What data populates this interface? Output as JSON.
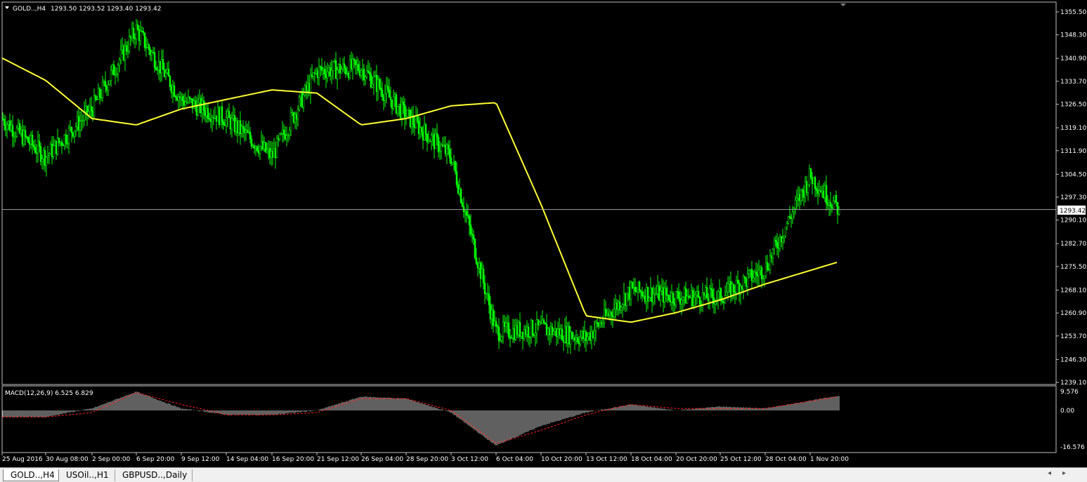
{
  "main_header": {
    "symbol_label": "GOLD..,H4",
    "ohlc": "1293.50 1293.52 1293.40 1293.42"
  },
  "price_axis": {
    "ticks": [
      "1355.50",
      "1348.30",
      "1340.90",
      "1333.70",
      "1326.50",
      "1319.10",
      "1311.90",
      "1304.50",
      "1297.30",
      "1290.10",
      "1282.70",
      "1275.50",
      "1268.10",
      "1260.90",
      "1253.70",
      "1246.30",
      "1239.10"
    ],
    "current_price": "1293.42"
  },
  "macd_header": "MACD(12,26,9) 6.525 6.829",
  "macd_axis": {
    "ticks": [
      "9.576",
      "0.00",
      "-16.576"
    ]
  },
  "time_axis": {
    "labels": [
      "25 Aug 2016",
      "30 Aug 08:00",
      "2 Sep 00:00",
      "6 Sep 20:00",
      "9 Sep 12:00",
      "14 Sep 04:00",
      "16 Sep 20:00",
      "21 Sep 12:00",
      "26 Sep 04:00",
      "28 Sep 20:00",
      "3 Oct 12:00",
      "6 Oct 04:00",
      "10 Oct 20:00",
      "13 Oct 12:00",
      "18 Oct 04:00",
      "20 Oct 20:00",
      "25 Oct 12:00",
      "28 Oct 04:00",
      "1 Nov 20:00"
    ]
  },
  "tabs": [
    {
      "label": "GOLD..,H4",
      "active": true
    },
    {
      "label": "USOil..,H1",
      "active": false
    },
    {
      "label": "GBPUSD..,Daily",
      "active": false
    }
  ],
  "colors": {
    "background": "#000000",
    "grid_text": "#ffffff",
    "candle": "#00ff00",
    "moving_average": "#ffff33",
    "macd_hist": "#c0c0c0",
    "macd_signal": "#ff2020"
  },
  "chart_data": {
    "type": "candlestick",
    "symbol": "GOLD..",
    "timeframe": "H4",
    "ylim": [
      1239.1,
      1358.0
    ],
    "indicators": [
      "moving average",
      "MACD(12,26,9)"
    ],
    "price_trend_keypoints": [
      {
        "x": "25 Aug 2016",
        "y": 1322
      },
      {
        "x": "30 Aug 08:00",
        "y": 1310
      },
      {
        "x": "2 Sep 00:00",
        "y": 1325
      },
      {
        "x": "6 Sep 20:00",
        "y": 1350
      },
      {
        "x": "9 Sep 12:00",
        "y": 1328
      },
      {
        "x": "14 Sep 04:00",
        "y": 1322
      },
      {
        "x": "16 Sep 20:00",
        "y": 1310
      },
      {
        "x": "21 Sep 12:00",
        "y": 1337
      },
      {
        "x": "26 Sep 04:00",
        "y": 1338
      },
      {
        "x": "28 Sep 20:00",
        "y": 1323
      },
      {
        "x": "3 Oct 12:00",
        "y": 1310
      },
      {
        "x": "6 Oct 04:00",
        "y": 1255
      },
      {
        "x": "10 Oct 20:00",
        "y": 1256
      },
      {
        "x": "13 Oct 12:00",
        "y": 1253
      },
      {
        "x": "18 Oct 04:00",
        "y": 1268
      },
      {
        "x": "20 Oct 20:00",
        "y": 1266
      },
      {
        "x": "25 Oct 12:00",
        "y": 1266
      },
      {
        "x": "28 Oct 04:00",
        "y": 1275
      },
      {
        "x": "1 Nov 20:00",
        "y": 1304
      },
      {
        "x": "last",
        "y": 1293.42
      }
    ],
    "ma_keypoints": [
      1341,
      1334,
      1322,
      1320,
      1325,
      1328,
      1331,
      1330,
      1320,
      1322,
      1326,
      1327,
      1295,
      1260,
      1258,
      1261,
      1265,
      1270,
      1277
    ],
    "macd_keypoints": [
      -3,
      -3,
      1,
      9.5,
      1,
      -2,
      -2,
      0,
      7,
      6,
      -1,
      -16,
      -7,
      -1,
      3,
      0,
      2,
      1,
      7.5
    ],
    "signal_keypoints": [
      -3,
      -3,
      -1,
      9,
      3,
      -2,
      -2,
      -1,
      6,
      6,
      0,
      -15,
      -9,
      -2,
      3,
      1,
      1,
      1,
      7
    ]
  }
}
